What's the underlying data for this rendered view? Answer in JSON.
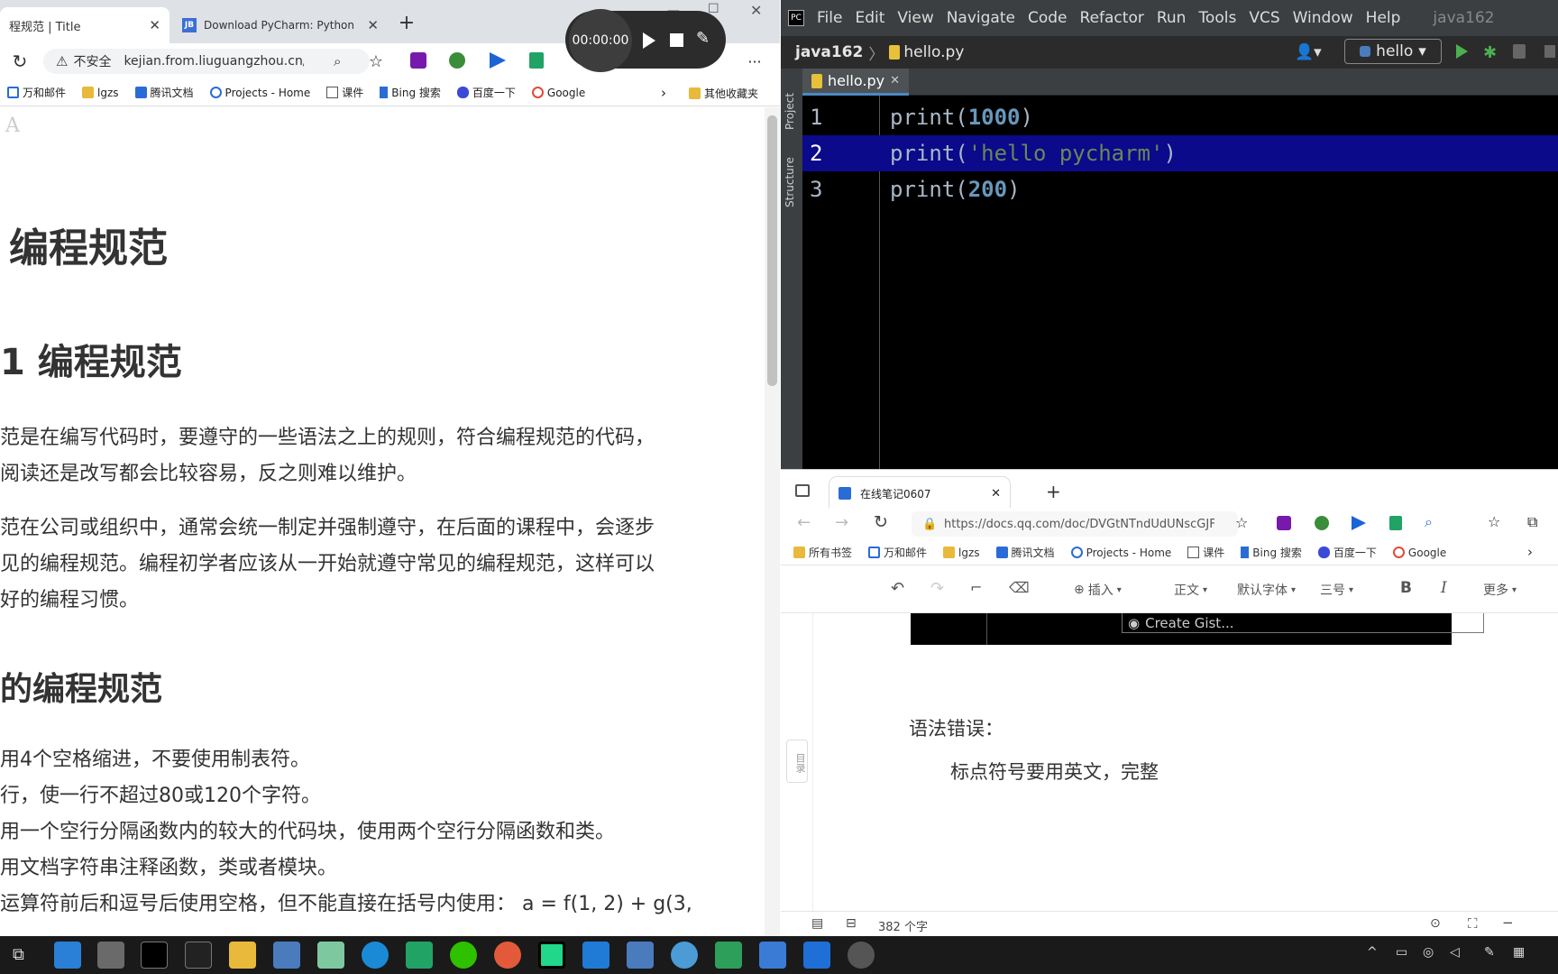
{
  "left_browser": {
    "tabs": [
      {
        "title": "程规范 | Title",
        "active": true
      },
      {
        "title": "Download PyCharm: Python IDE",
        "active": false
      }
    ],
    "security_label": "不安全",
    "url": "kejian.from.liuguangzhou.cn/p...",
    "bookmarks": [
      "万和邮件",
      "lgzs",
      "腾讯文档",
      "Projects - Home",
      "课件",
      "Bing 搜索",
      "百度一下",
      "Google"
    ],
    "other_bookmarks": "其他收藏夹",
    "content": {
      "top_letter": "A",
      "h1": "编程规范",
      "h2a": "1 编程规范",
      "p1a": "范是在编写代码时，要遵守的一些语法之上的规则，符合编程规范的代码，",
      "p1b": "阅读还是改写都会比较容易，反之则难以维护。",
      "p2a": "范在公司或组织中，通常会统一制定并强制遵守，在后面的课程中，会逐步",
      "p2b": "见的编程规范。编程初学者应该从一开始就遵守常见的编程规范，这样可以",
      "p2c": "好的编程习惯。",
      "h2b": "的编程规范",
      "l1": "用4个空格缩进，不要使用制表符。",
      "l2": "行，使一行不超过80或120个字符。",
      "l3": "用一个空行分隔函数内的较大的代码块，使用两个空行分隔函数和类。",
      "l4": "用文档字符串注释函数，类或者模块。",
      "l5": "运算符前后和逗号后使用空格，但不能直接在括号内使用：  a = f(1, 2) + g(3,"
    }
  },
  "recorder": {
    "time": "00:00:00"
  },
  "pycharm": {
    "menu": [
      "File",
      "Edit",
      "View",
      "Navigate",
      "Code",
      "Refactor",
      "Run",
      "Tools",
      "VCS",
      "Window",
      "Help"
    ],
    "project_title": "java162",
    "breadcrumb_project": "java162",
    "breadcrumb_file": "hello.py",
    "run_config": "hello",
    "side_labels": [
      "Project",
      "Structure"
    ],
    "tab": "hello.py",
    "lines": [
      {
        "n": "1",
        "fn": "print(",
        "arg": "1000",
        "type": "num",
        "end": ")"
      },
      {
        "n": "2",
        "fn": "print(",
        "arg": "'hello pycharm'",
        "type": "str",
        "end": ")"
      },
      {
        "n": "3",
        "fn": "print(",
        "arg": "200",
        "type": "num",
        "end": ")"
      }
    ],
    "selected_line": 2
  },
  "right_browser": {
    "tab": "在线笔记0607",
    "url": "https://docs.qq.com/doc/DVGtNTndUdUNscGJF",
    "bookmarks": [
      "所有书签",
      "万和邮件",
      "lgzs",
      "腾讯文档",
      "Projects - Home",
      "课件",
      "Bing 搜索",
      "百度一下",
      "Google"
    ],
    "toolbar": {
      "insert": "插入",
      "style": "正文",
      "font": "默认字体",
      "size": "三号",
      "bold": "B",
      "italic": "I",
      "more": "更多"
    },
    "gist_button": "Create Gist...",
    "toc_label": "目录",
    "doc_heading": "语法错误：",
    "doc_line": "标点符号要用英文，完整",
    "word_count": "382 个字"
  }
}
